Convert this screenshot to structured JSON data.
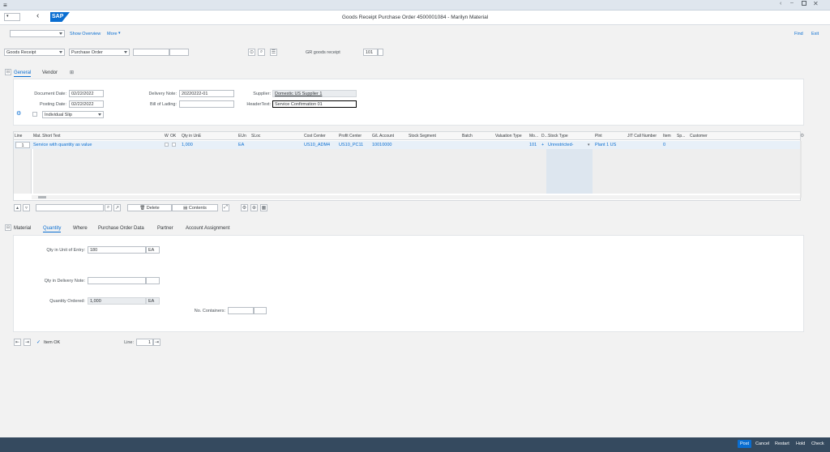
{
  "window": {
    "title": "Goods Receipt Purchase Order 4500001084 - Marilyn Material"
  },
  "shell": {
    "logo": "SAP",
    "show_overview": "Show Overview",
    "more": "More",
    "find": "Find",
    "exit": "Exit"
  },
  "toolbar": {
    "action": "Goods Receipt",
    "ref_doc": "Purchase Order",
    "git_label": "GR goods receipt",
    "movement_type": "101"
  },
  "header_tabs": [
    "General",
    "Vendor"
  ],
  "general": {
    "document_date_label": "Document Date:",
    "document_date": "02/22/2022",
    "posting_date_label": "Posting Date:",
    "posting_date": "02/22/2022",
    "delivery_note_label": "Delivery Note:",
    "delivery_note": "20220222-01",
    "bill_of_lading_label": "Bill of Lading:",
    "bill_of_lading": "",
    "supplier_label": "Supplier:",
    "supplier": "Domestic US Supplier 1",
    "header_text_label": "HeaderText:",
    "header_text": "Service Confirmation 01",
    "slip": "Individual Slip"
  },
  "grid": {
    "columns": [
      "Line",
      "Mat. Short Text",
      "W",
      "OK",
      "Qty in UnE",
      "EUn",
      "SLoc",
      "Cost Center",
      "Profit Center",
      "G/L Account",
      "Stock Segment",
      "Batch",
      "Valuation Type",
      "Mo...",
      "D...",
      "Stock Type",
      "Plnt",
      "JIT Call Number",
      "Item",
      "Sp...",
      "Customer"
    ],
    "rows": [
      {
        "line": "1",
        "text": "Service with quantity as value",
        "qty": "1,000",
        "eun": "EA",
        "cost_center": "US10_ADM4",
        "profit_center": "US10_PC11",
        "gl_account": "10010000",
        "mvt": "101",
        "plus": "+",
        "stock_type": "Unrestricted-",
        "plant": "Plant 1 US",
        "item": "0"
      }
    ]
  },
  "grid_toolbar": {
    "delete": "Delete",
    "contents": "Contents"
  },
  "detail_tabs": [
    "Material",
    "Quantity",
    "Where",
    "Purchase Order Data",
    "Partner",
    "Account Assignment"
  ],
  "quantity": {
    "qty_entry_label": "Qty in Unit of Entry:",
    "qty_entry": "180",
    "qty_entry_unit": "EA",
    "qty_delivery_label": "Qty in Delivery Note:",
    "qty_delivery": "",
    "qty_ordered_label": "Quantity Ordered:",
    "qty_ordered": "1,000",
    "qty_ordered_unit": "EA",
    "containers_label": "No. Containers:"
  },
  "bottom": {
    "item_ok": "Item OK",
    "line_label": "Line:",
    "line_value": "1"
  },
  "footer": {
    "post": "Post",
    "cancel": "Cancel",
    "restart": "Restart",
    "hold": "Hold",
    "check": "Check"
  }
}
